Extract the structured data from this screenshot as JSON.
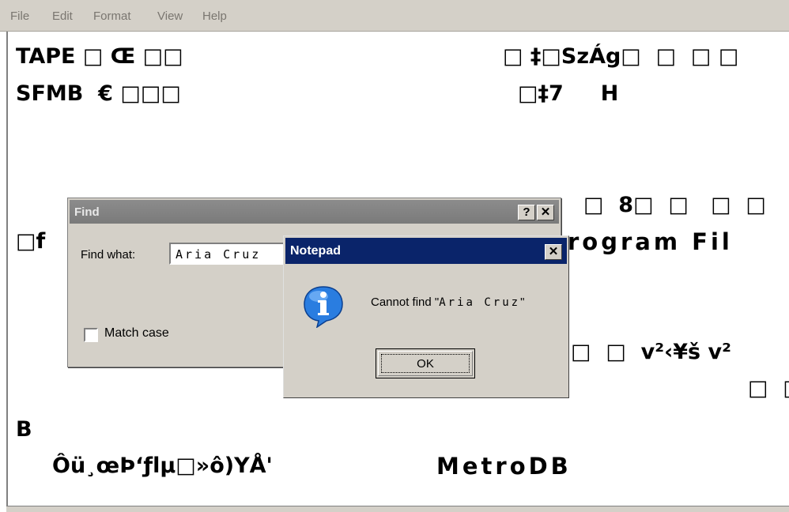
{
  "menu": {
    "file": "File",
    "edit": "Edit",
    "format": "Format",
    "view": "View",
    "help": "Help"
  },
  "editor": {
    "l1a": "TAPE □ Œ □□",
    "l1b": "□ ‡□SzÁg□  □  □ □",
    "l2a": "SFMB  € □□□",
    "l2b": "□‡7     H",
    "l3": "□  8□  □   □  □",
    "l4a": "□f",
    "l4b": "rogram Fil",
    "l5": "I□  □  v²‹¥š v²",
    "l6": "□  □",
    "l7": "B",
    "l8a": "Ôü¸œÞ‘ƒlµ□»ô)YÅ'",
    "l8b": "MetroDB"
  },
  "find_dialog": {
    "title": "Find",
    "help_btn": "?",
    "close_btn": "✕",
    "find_label": "Find what:",
    "find_value": "Aria Cruz",
    "match_case_label": "Match case",
    "match_case_checked": false
  },
  "message_box": {
    "title": "Notepad",
    "close_btn": "✕",
    "icon": "info-icon",
    "message_prefix": "Cannot find \"",
    "message_query": "Aria Cruz",
    "message_suffix": "\"",
    "ok_label": "OK"
  },
  "colors": {
    "dialog_bg": "#d4d0c8",
    "active_title": "#0a246a",
    "inactive_title": "#808080",
    "info_blue": "#1f6fd1"
  }
}
